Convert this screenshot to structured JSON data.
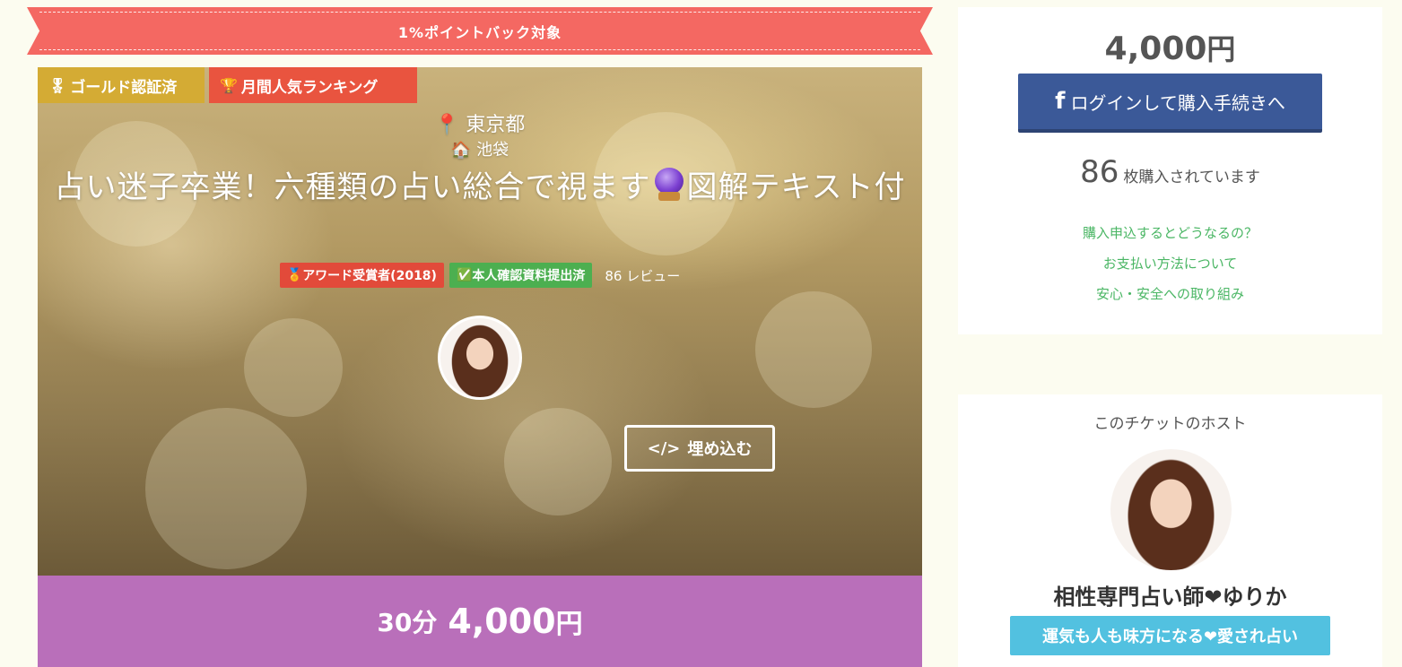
{
  "banner": {
    "text": "1%ポイントバック対象"
  },
  "hero": {
    "tags": {
      "gold": "ゴールド認証済",
      "ranking": "月間人気ランキング"
    },
    "location": {
      "prefecture": "東京都",
      "area": "池袋"
    },
    "title_part1": "占い迷子卒業！六種類の占い総合で視ます",
    "title_part2": "図解テキスト付",
    "badges": {
      "award": "アワード受賞者(2018)",
      "verified": "本人確認資料提出済"
    },
    "reviews": "86 レビュー",
    "embed_label": "埋め込む"
  },
  "price_bar": {
    "duration": "30分",
    "amount": "4,000",
    "currency": "円"
  },
  "purchase": {
    "price": "4,000",
    "currency": "円",
    "login_button": "ログインして購入手続きへ",
    "sold_count": "86",
    "sold_text": "枚購入されています",
    "links": [
      "購入申込するとどうなるの？",
      "お支払い方法について",
      "安心・安全への取り組み"
    ]
  },
  "host": {
    "heading": "このチケットのホスト",
    "name": "相性専門占い師❤ゆりか",
    "tagline": "運気も人も味方になる❤愛され占い"
  },
  "colors": {
    "ribbon": "#f46862",
    "gold_tag": "#d4ab34",
    "rank_tag": "#e9543f",
    "price_bar": "#b96fba",
    "facebook": "#3b5998",
    "link": "#4ab664",
    "tagline": "#52c1e0"
  }
}
